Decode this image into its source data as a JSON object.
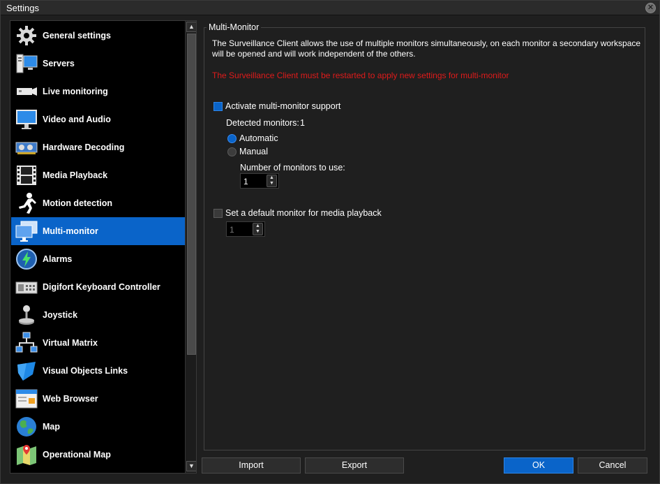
{
  "window": {
    "title": "Settings",
    "close_icon": "close-icon"
  },
  "sidebar": {
    "items": [
      {
        "label": "General settings",
        "icon": "gear-icon"
      },
      {
        "label": "Servers",
        "icon": "server-icon"
      },
      {
        "label": "Live monitoring",
        "icon": "camera-icon"
      },
      {
        "label": "Video and Audio",
        "icon": "monitor-icon"
      },
      {
        "label": "Hardware Decoding",
        "icon": "hardware-card-icon"
      },
      {
        "label": "Media Playback",
        "icon": "film-icon"
      },
      {
        "label": "Motion detection",
        "icon": "running-person-icon"
      },
      {
        "label": "Multi-monitor",
        "icon": "multi-monitor-icon",
        "selected": true
      },
      {
        "label": "Alarms",
        "icon": "lightning-icon"
      },
      {
        "label": "Digifort Keyboard Controller",
        "icon": "keyboard-controller-icon"
      },
      {
        "label": "Joystick",
        "icon": "joystick-icon"
      },
      {
        "label": "Virtual Matrix",
        "icon": "network-icon"
      },
      {
        "label": "Visual Objects Links",
        "icon": "shield-link-icon"
      },
      {
        "label": "Web Browser",
        "icon": "browser-icon"
      },
      {
        "label": "Map",
        "icon": "globe-icon"
      },
      {
        "label": "Operational Map",
        "icon": "map-pin-icon"
      }
    ]
  },
  "panel": {
    "group_title": "Multi-Monitor",
    "description": "The Surveillance Client allows the use of multiple monitors simultaneously, on each monitor a secondary workspace will be opened and will work independent of the others.",
    "warning": "The Surveillance Client must be restarted to apply new settings for multi-monitor",
    "activate_label": "Activate multi-monitor support",
    "activate_checked": true,
    "detected_label": "Detected monitors:",
    "detected_value": "1",
    "automatic_label": "Automatic",
    "manual_label": "Manual",
    "mode_selected": "Automatic",
    "number_label": "Number of monitors to use:",
    "number_value": "1",
    "default_monitor_label": "Set a default monitor for media playback",
    "default_monitor_checked": false,
    "default_monitor_value": "1"
  },
  "buttons": {
    "import": "Import",
    "export": "Export",
    "ok": "OK",
    "cancel": "Cancel"
  },
  "colors": {
    "accent": "#0a64c9",
    "warning": "#e01b1b",
    "background": "#1f1f1f"
  }
}
